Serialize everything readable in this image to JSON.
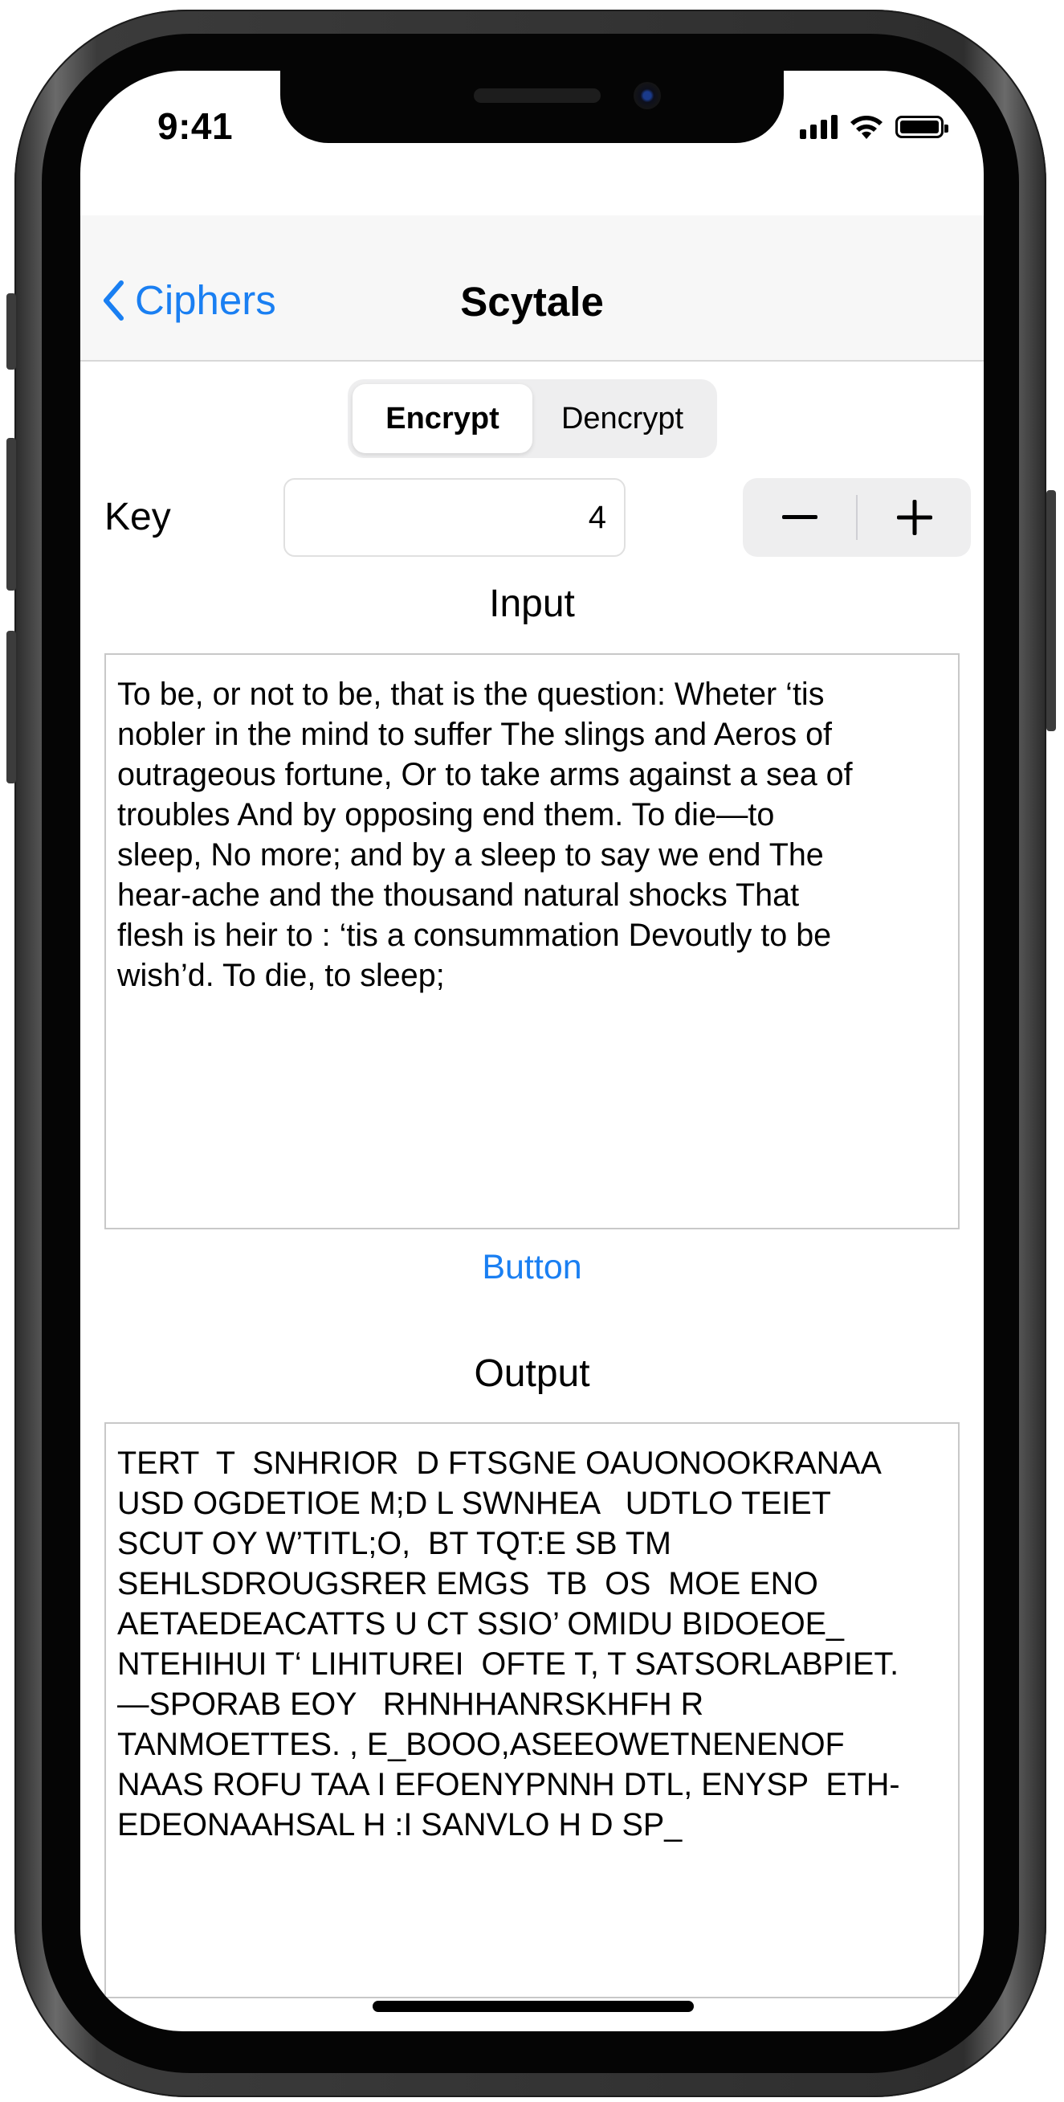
{
  "status_bar": {
    "time": "9:41"
  },
  "nav": {
    "back_label": "Ciphers",
    "title": "Scytale"
  },
  "mode_control": {
    "options": [
      "Encrypt",
      "Dencrypt"
    ],
    "selected": "Encrypt"
  },
  "key": {
    "label": "Key",
    "value": "4"
  },
  "input": {
    "label": "Input",
    "text": "To be, or not to be, that is the question: Wheter ‘tis\nnobler in the mind to suffer The slings and Aeros of\noutrageous fortune, Or to take arms against a sea of\ntroubles And by opposing end them. To die—to\nsleep, No more; and by a sleep to say we end The\nhear-ache and the thousand natural shocks That\nflesh is heir to : ‘tis a consummation Devoutly to be\nwish’d. To die, to sleep;"
  },
  "action_button": {
    "label": "Button"
  },
  "output": {
    "label": "Output",
    "text": "TERT  T  SNHRIOR  D FTSGNE OAUONOOKRANAA\nUSD OGDETIOE M;D L SWNHEA   UDTLO TEIET\nSCUT OY W’TITL;O,  BT TQT:E SB TM\nSEHLSDROUGSRER EMGS  TB  OS  MOE ENO\nAETAEDEACATTS U CT SSIO’ OMIDU BIDOEOE_\nNTEHIHUI T‘ LIHITUREI  OFTE T, T SATSORLABPIET.\n—SPORAB EOY   RHNHHANRSKHFH R\nTANMOETTES. , E_BOOO,ASEEOWETNENENOF\nNAAS ROFU TAA I EFOENYPNNH DTL, ENYSP  ETH-\nEDEONAAHSAL H :I SANVLO H D SP_"
  },
  "colors": {
    "accent": "#1a7ff2",
    "navbar_bg": "#f7f7f7",
    "control_bg": "#eeeeef"
  },
  "icons": [
    "chevron-left-icon",
    "cellular-signal-icon",
    "wifi-icon",
    "battery-icon",
    "minus-icon",
    "plus-icon"
  ]
}
